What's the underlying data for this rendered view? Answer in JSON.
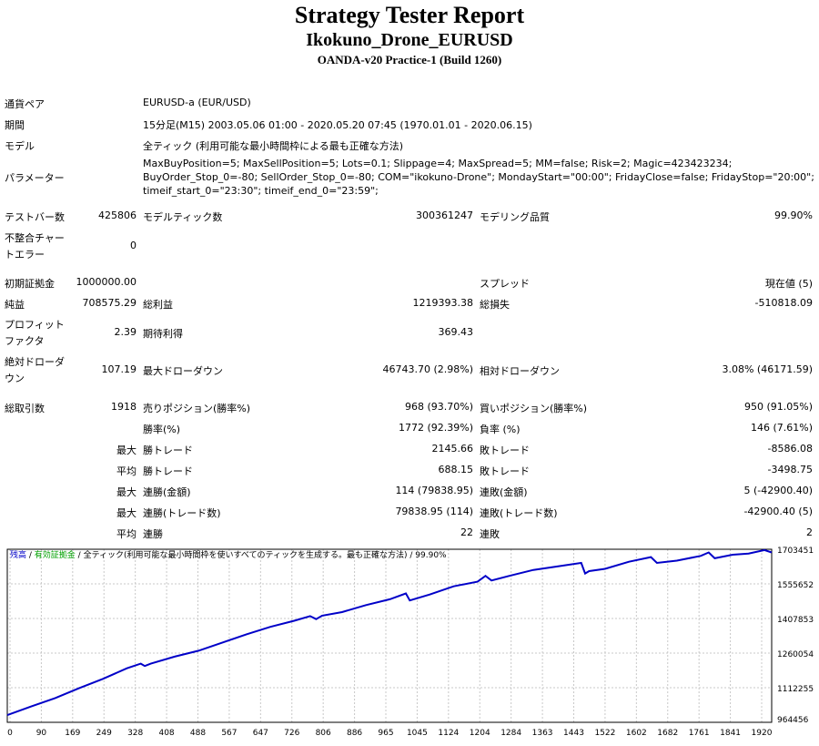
{
  "header": {
    "title": "Strategy Tester Report",
    "subtitle": "Ikokuno_Drone_EURUSD",
    "broker": "OANDA-v20 Practice-1 (Build 1260)"
  },
  "info": {
    "symbol_label": "通貨ペア",
    "symbol_value": "EURUSD-a (EUR/USD)",
    "period_label": "期間",
    "period_value": "15分足(M15) 2003.05.06 01:00 - 2020.05.20 07:45 (1970.01.01 - 2020.06.15)",
    "model_label": "モデル",
    "model_value": "全ティック (利用可能な最小時間枠による最も正確な方法)",
    "params_label": "パラメーター",
    "params_lines": [
      "MaxBuyPosition=5; MaxSellPosition=5; Lots=0.1; Slippage=4; MaxSpread=5; MM=false; Risk=2; Magic=423423234;",
      "BuyOrder_Stop_0=-80; SellOrder_Stop_0=-80; COM=\"ikokuno-Drone\"; MondayStart=\"00:00\"; FridayClose=false; FridayStop=\"20:00\";",
      "timeif_start_0=\"23:30\"; timeif_end_0=\"23:59\";"
    ]
  },
  "stats": {
    "bars_label": "テストバー数",
    "bars_value": "425806",
    "ticks_label": "モデルティック数",
    "ticks_value": "300361247",
    "quality_label": "モデリング品質",
    "quality_value": "99.90%",
    "mismatch_label_1": "不整合チャー",
    "mismatch_label_2": "トエラー",
    "mismatch_value": "0",
    "deposit_label": "初期証拠金",
    "deposit_value": "1000000.00",
    "spread_label": "スプレッド",
    "spread_value": "現在値 (5)",
    "net_label": "純益",
    "net_value": "708575.29",
    "gross_profit_label": "総利益",
    "gross_profit_value": "1219393.38",
    "gross_loss_label": "総損失",
    "gross_loss_value": "-510818.09",
    "pf_label_1": "プロフィット",
    "pf_label_2": "ファクタ",
    "pf_value": "2.39",
    "expected_label": "期待利得",
    "expected_value": "369.43",
    "abs_dd_label_1": "絶対ドローダ",
    "abs_dd_label_2": "ウン",
    "abs_dd_value": "107.19",
    "max_dd_label": "最大ドローダウン",
    "max_dd_value": "46743.70 (2.98%)",
    "rel_dd_label": "相対ドローダウン",
    "rel_dd_value": "3.08% (46171.59)",
    "total_trades_label": "総取引数",
    "total_trades_value": "1918",
    "short_label": "売りポジション(勝率%)",
    "short_value": "968 (93.70%)",
    "long_label": "買いポジション(勝率%)",
    "long_value": "950 (91.05%)",
    "winrate_label": "勝率(%)",
    "winrate_value": "1772 (92.39%)",
    "lossrate_label": "負率 (%)",
    "lossrate_value": "146 (7.61%)",
    "q_max": "最大",
    "q_avg": "平均",
    "win_trade_label": "勝トレード",
    "loss_trade_label": "敗トレード",
    "max_win_value": "2145.66",
    "max_loss_value": "-8586.08",
    "avg_win_value": "688.15",
    "avg_loss_value": "-3498.75",
    "consec_win_amt_label": "連勝(金額)",
    "consec_win_amt_value": "114 (79838.95)",
    "consec_loss_amt_label": "連敗(金額)",
    "consec_loss_amt_value": "5 (-42900.40)",
    "consec_win_cnt_label": "連勝(トレード数)",
    "consec_win_cnt_value": "79838.95 (114)",
    "consec_loss_cnt_label": "連敗(トレード数)",
    "consec_loss_cnt_value": "-42900.40 (5)",
    "avg_consec_win_label": "連勝",
    "avg_consec_win_value": "22",
    "avg_consec_loss_label": "連敗",
    "avg_consec_loss_value": "2"
  },
  "chart_data": {
    "type": "line",
    "legend": {
      "balance": "残高",
      "sep1": " / ",
      "margin": "有効証拠金",
      "sep2": " / ",
      "model_text": "全ティック(利用可能な最小時間枠を使いすべてのティックを生成する。最も正確な方法)",
      "quality": " / 99.90%"
    },
    "colors": {
      "balance": "#0000c8",
      "margin": "#00a000",
      "grid": "#c8c8c8"
    },
    "xlim": [
      0,
      1918
    ],
    "ylim": [
      964456,
      1703451
    ],
    "x_ticks": [
      "0",
      "90",
      "169",
      "249",
      "328",
      "408",
      "488",
      "567",
      "647",
      "726",
      "806",
      "886",
      "965",
      "1045",
      "1124",
      "1204",
      "1284",
      "1363",
      "1443",
      "1522",
      "1602",
      "1682",
      "1761",
      "1841",
      "1920"
    ],
    "y_ticks": [
      "1703451",
      "1555652",
      "1407853",
      "1260054",
      "1112255",
      "964456"
    ],
    "series": [
      {
        "x": [
          0,
          60,
          120,
          180,
          240,
          300,
          335,
          345,
          360,
          420,
          480,
          540,
          600,
          660,
          720,
          760,
          775,
          790,
          840,
          900,
          960,
          1000,
          1010,
          1060,
          1120,
          1180,
          1200,
          1215,
          1260,
          1320,
          1380,
          1440,
          1450,
          1460,
          1500,
          1560,
          1615,
          1630,
          1680,
          1740,
          1760,
          1775,
          1820,
          1860,
          1900,
          1918
        ],
        "y": [
          995000,
          1032000,
          1068000,
          1110000,
          1150000,
          1195000,
          1215000,
          1205000,
          1215000,
          1245000,
          1270000,
          1305000,
          1340000,
          1372000,
          1398000,
          1418000,
          1405000,
          1420000,
          1435000,
          1465000,
          1490000,
          1515000,
          1485000,
          1510000,
          1545000,
          1565000,
          1590000,
          1570000,
          1590000,
          1615000,
          1630000,
          1645000,
          1600000,
          1610000,
          1620000,
          1650000,
          1670000,
          1645000,
          1655000,
          1675000,
          1690000,
          1665000,
          1680000,
          1685000,
          1700000,
          1690000
        ]
      }
    ]
  }
}
